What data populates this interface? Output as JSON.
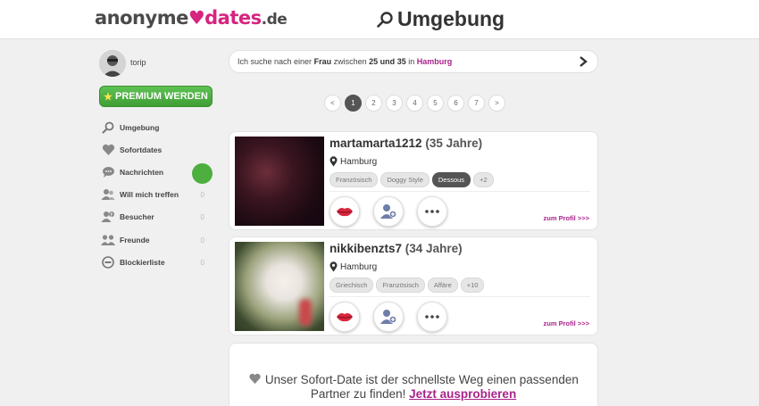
{
  "header": {
    "logo": {
      "part1": "anonyme",
      "part2": "dates",
      "tld": ".de"
    },
    "title": "Umgebung"
  },
  "user": {
    "name": "torip"
  },
  "premium_button": {
    "label": "PREMIUM WERDEN"
  },
  "sidebar": {
    "items": [
      {
        "label": "Umgebung",
        "icon": "search-icon"
      },
      {
        "label": "Sofortdates",
        "icon": "heart-icon"
      },
      {
        "label": "Nachrichten",
        "icon": "chat-icon"
      },
      {
        "label": "Will mich treffen",
        "icon": "users-icon",
        "count": "0"
      },
      {
        "label": "Besucher",
        "icon": "visitor-icon",
        "count": "0"
      },
      {
        "label": "Freunde",
        "icon": "friends-icon",
        "count": "0"
      },
      {
        "label": "Blockierliste",
        "icon": "block-icon",
        "count": "0"
      }
    ]
  },
  "search": {
    "prefix": "Ich suche nach einer",
    "gender": "Frau",
    "between": "zwischen",
    "age_from": "25",
    "and": "und",
    "age_to": "35",
    "in": "in",
    "city": "Hamburg"
  },
  "pagination": {
    "prev": "<",
    "pages": [
      "1",
      "2",
      "3",
      "4",
      "5",
      "6",
      "7"
    ],
    "next": ">",
    "active": "1"
  },
  "profiles": [
    {
      "username": "martamarta1212",
      "age": "(35 Jahre)",
      "location": "Hamburg",
      "tags": [
        "Französisch",
        "Doggy Style",
        "Dessous",
        "+2"
      ],
      "profile_link": "zum Profil >>>"
    },
    {
      "username": "nikkibenzts7",
      "age": "(34 Jahre)",
      "location": "Hamburg",
      "tags": [
        "Griechisch",
        "Französisch",
        "Affäre",
        "+10"
      ],
      "profile_link": "zum Profil >>>"
    }
  ],
  "promo": {
    "text": "Unser Sofort-Date ist der schnellste Weg einen passenden Partner zu finden!",
    "link": "Jetzt ausprobieren"
  },
  "colors": {
    "accent": "#a8238a",
    "brand_pink": "#d6247f",
    "premium_green": "#4caf3e"
  }
}
